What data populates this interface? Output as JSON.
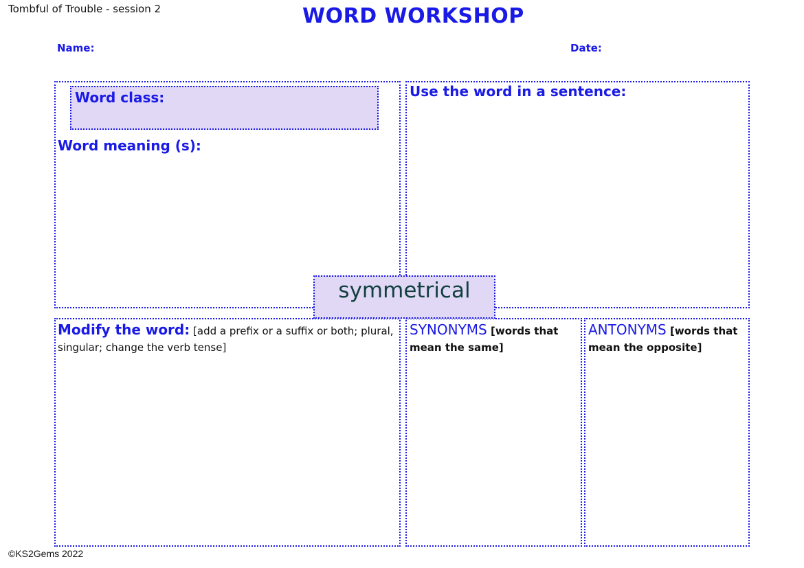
{
  "header": {
    "session": "Tombful of Trouble - session 2",
    "title": "WORD WORKSHOP",
    "name_label": "Name:",
    "date_label": "Date:"
  },
  "panels": {
    "word_class_label": "Word class:",
    "word_meaning_label": "Word meaning (s):",
    "sentence_label": "Use the word in a sentence:",
    "keyword": "symmetrical",
    "modify_label": "Modify the word:",
    "modify_hint": "[add a prefix or a suffix or both; plural, singular; change the verb tense]",
    "synonyms_label": "SYNONYMS",
    "synonyms_hint": "[words that mean the same]",
    "antonyms_label": "ANTONYMS",
    "antonyms_hint": "[words that mean the opposite]"
  },
  "footer": {
    "copyright": "©KS2Gems 2022"
  },
  "colors": {
    "accent": "#1a1ae6",
    "highlight_fill": "#e0d8f5",
    "keyword_text": "#124040"
  }
}
